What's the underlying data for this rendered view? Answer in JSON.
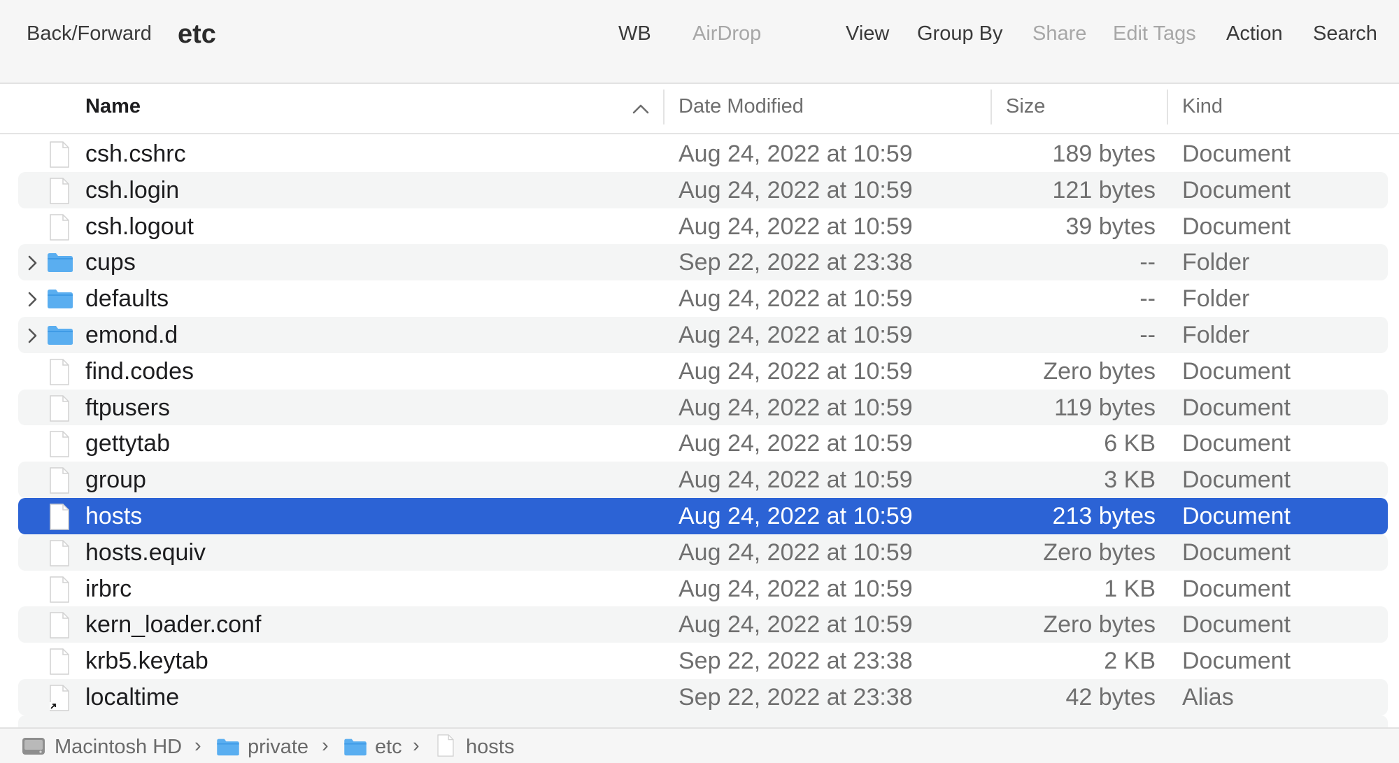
{
  "window": {
    "title": "etc"
  },
  "toolbar": {
    "back_forward": "Back/Forward",
    "wb": "WB",
    "airdrop": "AirDrop",
    "view": "View",
    "group_by": "Group By",
    "share": "Share",
    "edit_tags": "Edit Tags",
    "action": "Action",
    "search": "Search"
  },
  "columns": {
    "name": "Name",
    "date": "Date Modified",
    "size": "Size",
    "kind": "Kind",
    "sort": "ascending"
  },
  "rows": [
    {
      "name": "csh.cshrc",
      "date": "Aug 24, 2022 at 10:59",
      "size": "189 bytes",
      "kind": "Document",
      "icon": "document-icon"
    },
    {
      "name": "csh.login",
      "date": "Aug 24, 2022 at 10:59",
      "size": "121 bytes",
      "kind": "Document",
      "icon": "document-icon"
    },
    {
      "name": "csh.logout",
      "date": "Aug 24, 2022 at 10:59",
      "size": "39 bytes",
      "kind": "Document",
      "icon": "document-icon"
    },
    {
      "name": "cups",
      "date": "Sep 22, 2022 at 23:38",
      "size": "--",
      "kind": "Folder",
      "icon": "folder-icon"
    },
    {
      "name": "defaults",
      "date": "Aug 24, 2022 at 10:59",
      "size": "--",
      "kind": "Folder",
      "icon": "folder-icon"
    },
    {
      "name": "emond.d",
      "date": "Aug 24, 2022 at 10:59",
      "size": "--",
      "kind": "Folder",
      "icon": "folder-icon"
    },
    {
      "name": "find.codes",
      "date": "Aug 24, 2022 at 10:59",
      "size": "Zero bytes",
      "kind": "Document",
      "icon": "document-icon"
    },
    {
      "name": "ftpusers",
      "date": "Aug 24, 2022 at 10:59",
      "size": "119 bytes",
      "kind": "Document",
      "icon": "document-icon"
    },
    {
      "name": "gettytab",
      "date": "Aug 24, 2022 at 10:59",
      "size": "6 KB",
      "kind": "Document",
      "icon": "document-icon"
    },
    {
      "name": "group",
      "date": "Aug 24, 2022 at 10:59",
      "size": "3 KB",
      "kind": "Document",
      "icon": "document-icon"
    },
    {
      "name": "hosts",
      "date": "Aug 24, 2022 at 10:59",
      "size": "213 bytes",
      "kind": "Document",
      "icon": "document-icon",
      "selected": true
    },
    {
      "name": "hosts.equiv",
      "date": "Aug 24, 2022 at 10:59",
      "size": "Zero bytes",
      "kind": "Document",
      "icon": "document-icon"
    },
    {
      "name": "irbrc",
      "date": "Aug 24, 2022 at 10:59",
      "size": "1 KB",
      "kind": "Document",
      "icon": "document-icon"
    },
    {
      "name": "kern_loader.conf",
      "date": "Aug 24, 2022 at 10:59",
      "size": "Zero bytes",
      "kind": "Document",
      "icon": "document-icon"
    },
    {
      "name": "krb5.keytab",
      "date": "Sep 22, 2022 at 23:38",
      "size": "2 KB",
      "kind": "Document",
      "icon": "document-icon"
    },
    {
      "name": "localtime",
      "date": "Sep 22, 2022 at 23:38",
      "size": "42 bytes",
      "kind": "Alias",
      "icon": "alias-icon"
    }
  ],
  "pathbar": {
    "items": [
      "Macintosh HD",
      "private",
      "etc",
      "hosts"
    ]
  },
  "colors": {
    "selection": "#2c63d5",
    "folder": "#5aaef0",
    "alt_row": "#f4f5f5"
  }
}
